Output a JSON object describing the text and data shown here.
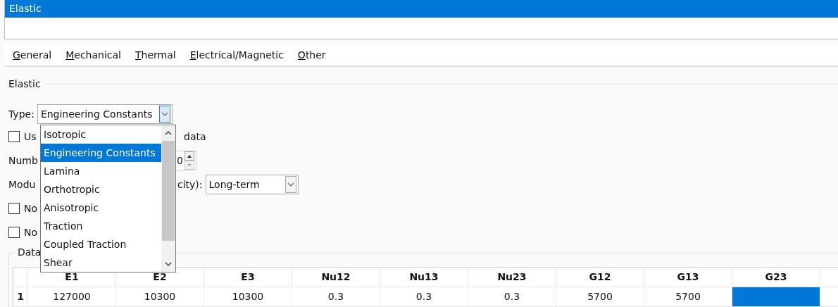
{
  "list_title": "Elastic",
  "menu": [
    "General",
    "Mechanical",
    "Thermal",
    "Electrical/Magnetic",
    "Other"
  ],
  "section": "Elastic",
  "type_field": {
    "label": "Type:",
    "value": "Engineering Constants"
  },
  "dropdown": [
    {
      "label": "Isotropic",
      "selected": false
    },
    {
      "label": "Engineering Constants",
      "selected": true
    },
    {
      "label": "Lamina",
      "selected": false
    },
    {
      "label": "Orthotropic",
      "selected": false
    },
    {
      "label": "Anisotropic",
      "selected": false
    },
    {
      "label": "Traction",
      "selected": false
    },
    {
      "label": "Coupled Traction",
      "selected": false
    },
    {
      "label": "Shear",
      "selected": false
    }
  ],
  "rows": [
    {
      "kind": "checkbox",
      "label": "Us",
      "checked": false,
      "tail": "data"
    },
    {
      "kind": "spinner",
      "label": "Numb",
      "value": "0"
    },
    {
      "kind": "combo",
      "label": "Modu",
      "tail": "city):",
      "value": "Long-term"
    },
    {
      "kind": "checkbox",
      "label": "No",
      "checked": false
    },
    {
      "kind": "checkbox",
      "label": "No",
      "checked": false
    }
  ],
  "data_group": "Data",
  "table": {
    "columns": [
      "E1",
      "E2",
      "E3",
      "Nu12",
      "Nu13",
      "Nu23",
      "G12",
      "G13",
      "G23"
    ],
    "rows": [
      {
        "header": "1",
        "cells": [
          {
            "value": "127000",
            "selected": false
          },
          {
            "value": "10300",
            "selected": false
          },
          {
            "value": "10300",
            "selected": false
          },
          {
            "value": "0.3",
            "selected": false
          },
          {
            "value": "0.3",
            "selected": false
          },
          {
            "value": "0.3",
            "selected": false
          },
          {
            "value": "5700",
            "selected": false
          },
          {
            "value": "5700",
            "selected": false
          },
          {
            "selected": true
          }
        ]
      }
    ]
  }
}
